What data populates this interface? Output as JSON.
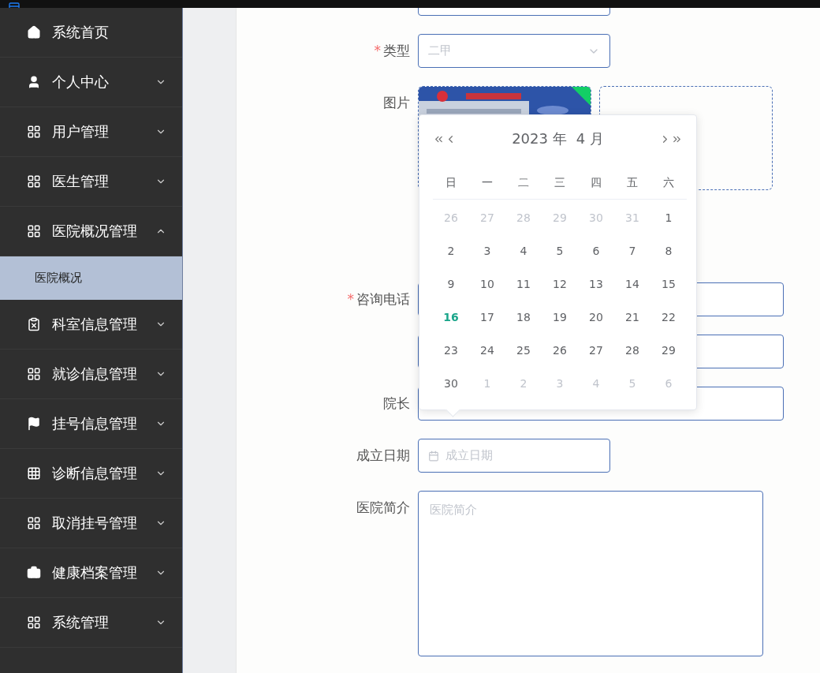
{
  "sidebar": {
    "items": [
      {
        "label": "系统首页",
        "kind": "link"
      },
      {
        "label": "个人中心",
        "kind": "group",
        "expanded": false
      },
      {
        "label": "用户管理",
        "kind": "group",
        "expanded": false
      },
      {
        "label": "医生管理",
        "kind": "group",
        "expanded": false
      },
      {
        "label": "医院概况管理",
        "kind": "group",
        "expanded": true,
        "children": [
          {
            "label": "医院概况",
            "selected": true
          }
        ]
      },
      {
        "label": "科室信息管理",
        "kind": "group",
        "expanded": false
      },
      {
        "label": "就诊信息管理",
        "kind": "group",
        "expanded": false
      },
      {
        "label": "挂号信息管理",
        "kind": "group",
        "expanded": false
      },
      {
        "label": "诊断信息管理",
        "kind": "group",
        "expanded": false
      },
      {
        "label": "取消挂号管理",
        "kind": "group",
        "expanded": false
      },
      {
        "label": "健康档案管理",
        "kind": "group",
        "expanded": false
      },
      {
        "label": "系统管理",
        "kind": "group",
        "expanded": false
      }
    ]
  },
  "form": {
    "fields": [
      {
        "kind": "short-input"
      },
      {
        "kind": "select",
        "label": "类型",
        "required_mark": "*",
        "value": "二甲"
      },
      {
        "kind": "upload",
        "label": "图片"
      },
      {
        "kind": "input",
        "label": "咨询电话",
        "required_mark": "*"
      },
      {
        "kind": "input"
      },
      {
        "kind": "input",
        "label": "院长"
      },
      {
        "kind": "date",
        "label": "成立日期",
        "placeholder": "成立日期"
      },
      {
        "kind": "textarea",
        "label": "医院简介",
        "placeholder": "医院简介"
      }
    ]
  },
  "datepicker": {
    "year": "2023 年",
    "month": "4 月",
    "weekdays": [
      "日",
      "一",
      "二",
      "三",
      "四",
      "五",
      "六"
    ],
    "days": [
      {
        "label": "26",
        "outside": true,
        "today": false
      },
      {
        "label": "27",
        "outside": true,
        "today": false
      },
      {
        "label": "28",
        "outside": true,
        "today": false
      },
      {
        "label": "29",
        "outside": true,
        "today": false
      },
      {
        "label": "30",
        "outside": true,
        "today": false
      },
      {
        "label": "31",
        "outside": true,
        "today": false
      },
      {
        "label": "1",
        "outside": false,
        "today": false
      },
      {
        "label": "2",
        "outside": false,
        "today": false
      },
      {
        "label": "3",
        "outside": false,
        "today": false
      },
      {
        "label": "4",
        "outside": false,
        "today": false
      },
      {
        "label": "5",
        "outside": false,
        "today": false
      },
      {
        "label": "6",
        "outside": false,
        "today": false
      },
      {
        "label": "7",
        "outside": false,
        "today": false
      },
      {
        "label": "8",
        "outside": false,
        "today": false
      },
      {
        "label": "9",
        "outside": false,
        "today": false
      },
      {
        "label": "10",
        "outside": false,
        "today": false
      },
      {
        "label": "11",
        "outside": false,
        "today": false
      },
      {
        "label": "12",
        "outside": false,
        "today": false
      },
      {
        "label": "13",
        "outside": false,
        "today": false
      },
      {
        "label": "14",
        "outside": false,
        "today": false
      },
      {
        "label": "15",
        "outside": false,
        "today": false
      },
      {
        "label": "16",
        "outside": false,
        "today": true
      },
      {
        "label": "17",
        "outside": false,
        "today": false
      },
      {
        "label": "18",
        "outside": false,
        "today": false
      },
      {
        "label": "19",
        "outside": false,
        "today": false
      },
      {
        "label": "20",
        "outside": false,
        "today": false
      },
      {
        "label": "21",
        "outside": false,
        "today": false
      },
      {
        "label": "22",
        "outside": false,
        "today": false
      },
      {
        "label": "23",
        "outside": false,
        "today": false
      },
      {
        "label": "24",
        "outside": false,
        "today": false
      },
      {
        "label": "25",
        "outside": false,
        "today": false
      },
      {
        "label": "26",
        "outside": false,
        "today": false
      },
      {
        "label": "27",
        "outside": false,
        "today": false
      },
      {
        "label": "28",
        "outside": false,
        "today": false
      },
      {
        "label": "29",
        "outside": false,
        "today": false
      },
      {
        "label": "30",
        "outside": false,
        "today": false
      },
      {
        "label": "1",
        "outside": true,
        "today": false
      },
      {
        "label": "2",
        "outside": true,
        "today": false
      },
      {
        "label": "3",
        "outside": true,
        "today": false
      },
      {
        "label": "4",
        "outside": true,
        "today": false
      },
      {
        "label": "5",
        "outside": true,
        "today": false
      },
      {
        "label": "6",
        "outside": true,
        "today": false
      }
    ]
  }
}
